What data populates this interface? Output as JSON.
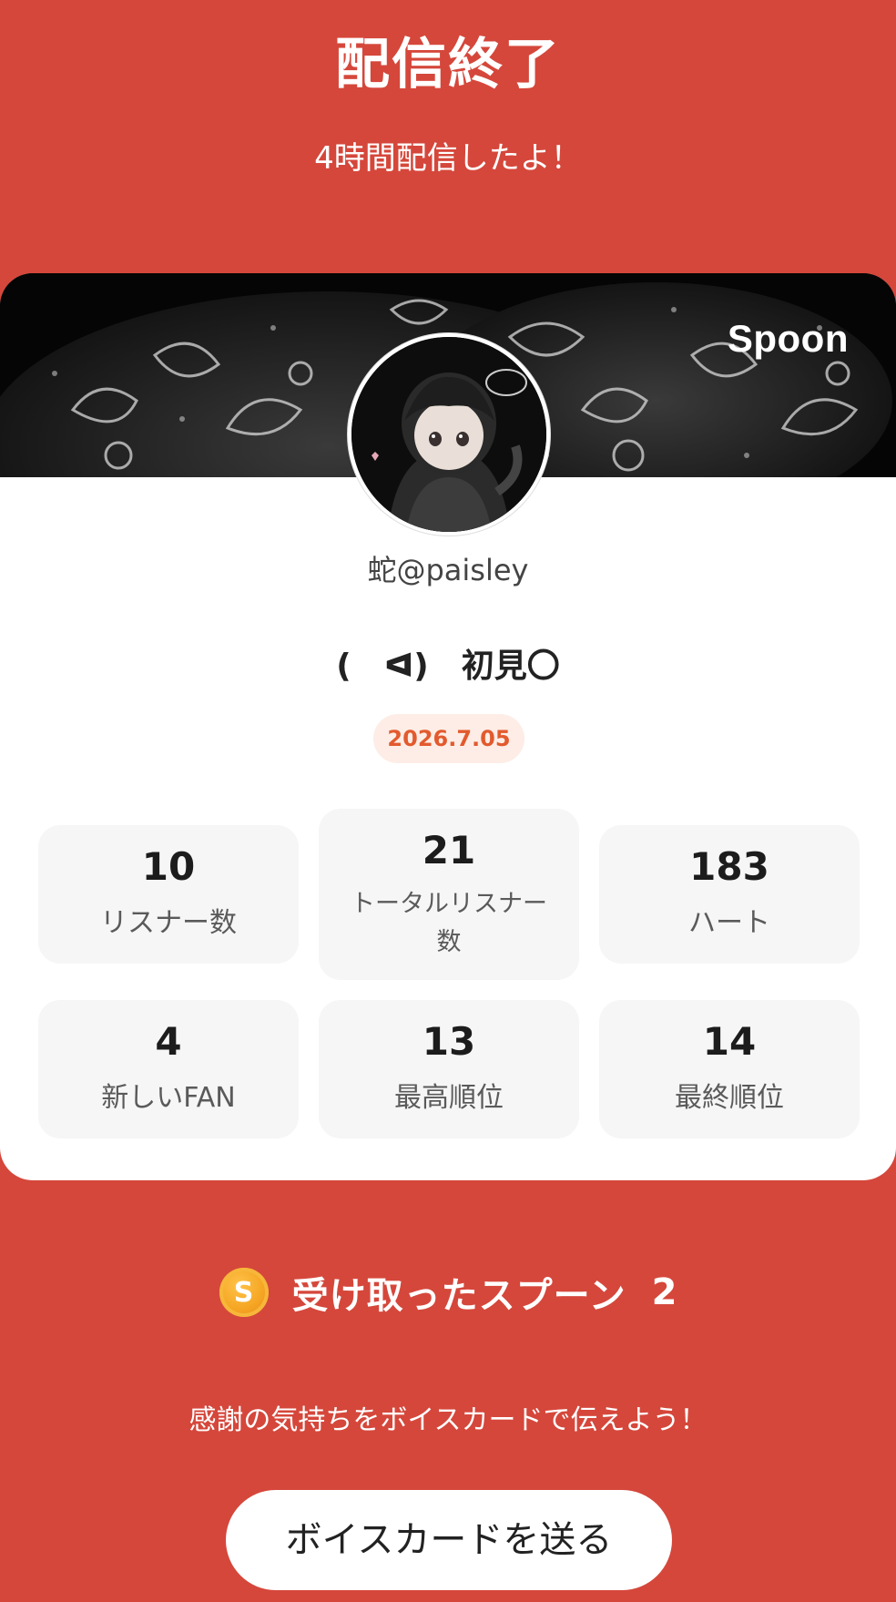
{
  "header": {
    "title": "配信終了",
    "subtitle": "4時間配信したよ！"
  },
  "card": {
    "brand": "Spoon",
    "username": "蛇@paisley",
    "stream_title": "(　ᐊ)　初見〇",
    "date": "2026.7.05",
    "stats": [
      {
        "value": "10",
        "label": "リスナー数"
      },
      {
        "value": "21",
        "label": "トータルリスナー数"
      },
      {
        "value": "183",
        "label": "ハート"
      },
      {
        "value": "4",
        "label": "新しいFAN"
      },
      {
        "value": "13",
        "label": "最高順位"
      },
      {
        "value": "14",
        "label": "最終順位"
      }
    ]
  },
  "spoons": {
    "coin_letter": "S",
    "label": "受け取ったスプーン",
    "count": "2"
  },
  "voice_card": {
    "prompt": "感謝の気持ちをボイスカードで伝えよう！",
    "button_label": "ボイスカードを送る"
  },
  "colors": {
    "background": "#D5473B",
    "card": "#FFFFFF",
    "date_badge_bg": "#FDEDE6",
    "date_badge_text": "#E25A2E",
    "stat_box": "#F6F6F6"
  }
}
